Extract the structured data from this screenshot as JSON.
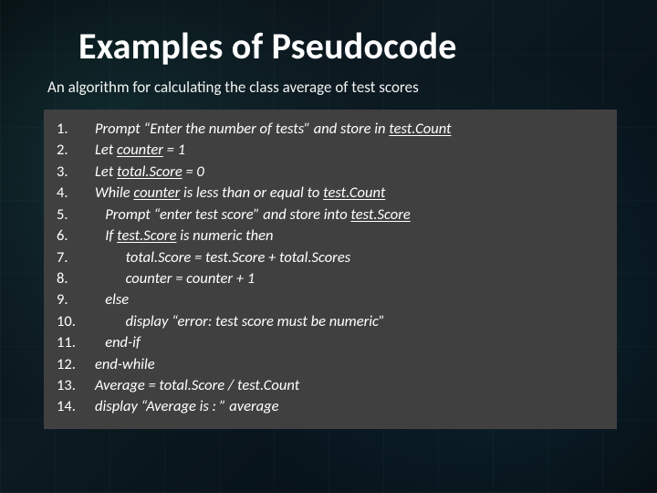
{
  "title": "Examples of Pseudocode",
  "subtitle": "An algorithm for calculating the class average of test scores",
  "lines": {
    "l1": "Prompt “Enter the number of tests” and store in ",
    "l1v": "test.Count",
    "l2a": "Let ",
    "l2v": "counter",
    "l2b": " = 1",
    "l3a": "Let ",
    "l3v": "total.Score",
    "l3b": " = 0",
    "l4a": "While ",
    "l4v1": "counter",
    "l4b": " is less than or equal to ",
    "l4v2": "test.Count",
    "l5": "   Prompt “enter test score” and store into ",
    "l5v": "test.Score",
    "l6a": "   If ",
    "l6v": "test.Score",
    "l6b": " is numeric then",
    "l7": "         total.Score = test.Score + total.Scores",
    "l8": "         counter = counter + 1",
    "l9": "   else",
    "l10": "         display “error: test score must be numeric”",
    "l11": "   end-if",
    "l12": "end-while",
    "l13": "Average = total.Score / test.Count",
    "l14": "display “Average is : ” average"
  }
}
